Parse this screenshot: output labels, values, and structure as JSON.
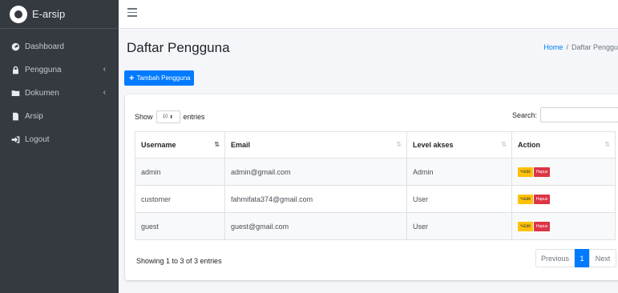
{
  "app": {
    "brand": "E-arsip"
  },
  "sidebar": {
    "items": [
      {
        "label": "Dashboard",
        "icon": "dashboard-icon"
      },
      {
        "label": "Pengguna",
        "icon": "lock-icon",
        "chevron": "‹"
      },
      {
        "label": "Dokumen",
        "icon": "folder-icon",
        "chevron": "‹"
      },
      {
        "label": "Arsip",
        "icon": "file-icon"
      },
      {
        "label": "Logout",
        "icon": "sign-out-icon"
      }
    ]
  },
  "header": {
    "title": "Daftar Pengguna",
    "breadcrumb": {
      "home": "Home",
      "separator": "/",
      "current": "Daftar Penggu"
    }
  },
  "actions": {
    "add_user": "Tambah Pengguna"
  },
  "table_controls": {
    "show_prefix": "Show",
    "entries_value": "10",
    "show_suffix": "entries",
    "search_label": "Search:",
    "search_value": ""
  },
  "table": {
    "columns": [
      "Username",
      "Email",
      "Level akses",
      "Action"
    ],
    "rows": [
      {
        "username": "admin",
        "email": "admin@gmail.com",
        "level": "Admin"
      },
      {
        "username": "customer",
        "email": "fahmifata374@gmail.com",
        "level": "User"
      },
      {
        "username": "guest",
        "email": "guest@gmail.com",
        "level": "User"
      }
    ],
    "edit_label": "Edit",
    "delete_label": "Hapus"
  },
  "footer": {
    "showing": "Showing 1 to 3 of 3 entries",
    "prev": "Previous",
    "page": "1",
    "next": "Next"
  },
  "colors": {
    "sidebar_bg": "#343a40",
    "primary": "#007bff",
    "warning": "#ffc107",
    "danger": "#dc3545"
  }
}
